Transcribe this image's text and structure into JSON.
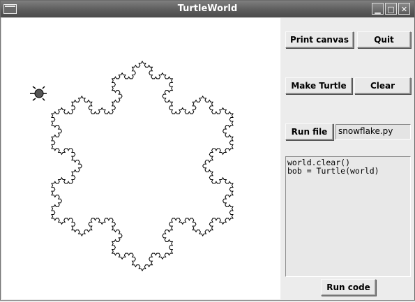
{
  "window": {
    "title": "TurtleWorld",
    "controls": {
      "minimize": "▁",
      "maximize": "□",
      "close": "✕"
    }
  },
  "panel": {
    "print_canvas_label": "Print canvas",
    "quit_label": "Quit",
    "make_turtle_label": "Make Turtle",
    "clear_label": "Clear",
    "run_file_label": "Run file",
    "filename_value": "snowflake.py",
    "code_text": "world.clear()\nbob = Turtle(world)",
    "run_code_label": "Run code"
  },
  "canvas": {
    "drawing": "koch-snowflake",
    "koch_level": 4,
    "stroke_color": "#000000",
    "turtle_color": "#555555"
  }
}
